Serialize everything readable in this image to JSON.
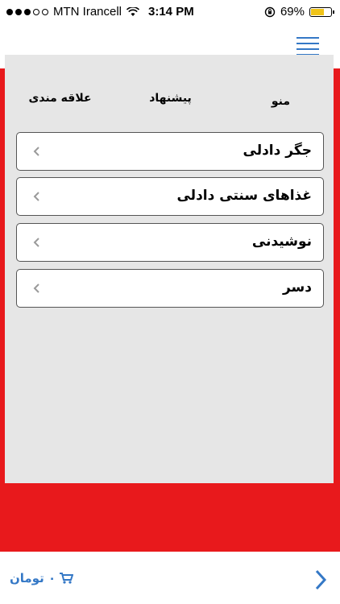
{
  "status": {
    "carrier": "MTN Irancell",
    "time": "3:14 PM",
    "battery": "69%",
    "battery_level": 0.69,
    "signal_icons": [
      "signal-dots-icon",
      "wifi-icon",
      "rotation-lock-icon",
      "battery-icon"
    ]
  },
  "tabs": [
    {
      "label": "منو",
      "active": true
    },
    {
      "label": "پیشنهاد",
      "active": false
    },
    {
      "label": "علاقه مندی",
      "active": false
    }
  ],
  "menu": {
    "items": [
      {
        "label": "جگر دادلی"
      },
      {
        "label": "غذاهای سنتی دادلی"
      },
      {
        "label": "نوشیدنی"
      },
      {
        "label": "دسر"
      }
    ]
  },
  "cart": {
    "amount": "۰ تومان"
  },
  "colors": {
    "accent": "#3478c6",
    "panel_red": "#e8191c",
    "panel_gray": "#e6e6e6"
  }
}
